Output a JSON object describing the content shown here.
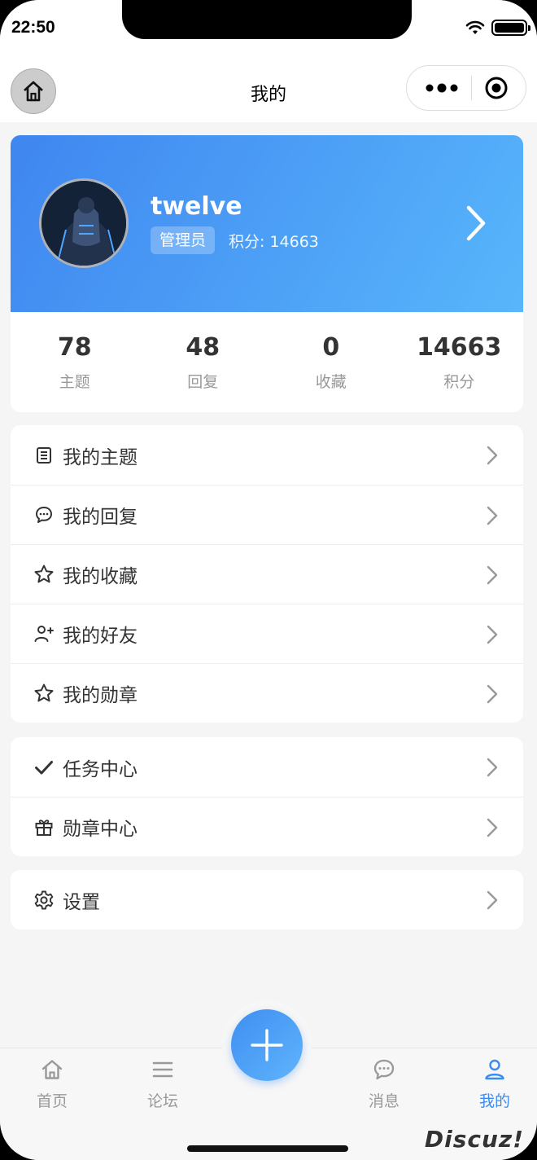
{
  "status_bar": {
    "time": "22:50"
  },
  "nav": {
    "title": "我的"
  },
  "profile": {
    "username": "twelve",
    "role": "管理员",
    "points_text": "积分: 14663"
  },
  "stats": [
    {
      "value": "78",
      "label": "主题"
    },
    {
      "value": "48",
      "label": "回复"
    },
    {
      "value": "0",
      "label": "收藏"
    },
    {
      "value": "14663",
      "label": "积分"
    }
  ],
  "menu_groups": [
    [
      {
        "label": "我的主题",
        "icon": "document-icon"
      },
      {
        "label": "我的回复",
        "icon": "chat-bubble-icon"
      },
      {
        "label": "我的收藏",
        "icon": "star-icon"
      },
      {
        "label": "我的好友",
        "icon": "add-friend-icon"
      },
      {
        "label": "我的勋章",
        "icon": "star-icon"
      }
    ],
    [
      {
        "label": "任务中心",
        "icon": "checkmark-icon"
      },
      {
        "label": "勋章中心",
        "icon": "gift-icon"
      }
    ],
    [
      {
        "label": "设置",
        "icon": "gear-icon"
      }
    ]
  ],
  "tabs": [
    {
      "label": "首页",
      "icon": "home-icon",
      "active": false
    },
    {
      "label": "论坛",
      "icon": "list-icon",
      "active": false
    },
    {
      "label": "消息",
      "icon": "chat-bubble-icon",
      "active": false
    },
    {
      "label": "我的",
      "icon": "user-icon",
      "active": true
    }
  ],
  "watermark": "Discuz!",
  "colors": {
    "accent": "#3b8cf2",
    "header_start": "#3f86f0",
    "header_end": "#58b6fb"
  }
}
